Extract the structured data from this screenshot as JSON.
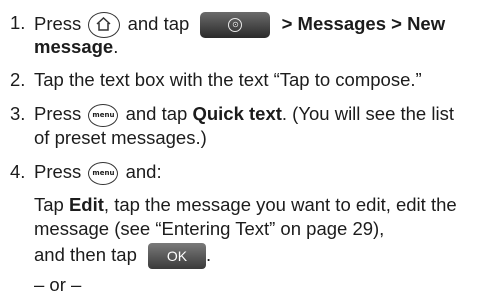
{
  "steps": [
    {
      "num": "1.",
      "press": "Press",
      "and_tap": "and tap",
      "path": "> Messages > New",
      "path_cont": "message",
      "period": "."
    },
    {
      "num": "2.",
      "text": "Tap the text box with the text “Tap to compose.”"
    },
    {
      "num": "3.",
      "press": "Press",
      "and_tap": "and tap",
      "bold": "Quick text",
      "rest": ". (You will see the list",
      "line2": "of preset messages.)"
    },
    {
      "num": "4.",
      "press": "Press",
      "and": "and:",
      "sub_tap": "Tap",
      "sub_edit": "Edit",
      "sub_rest": ", tap the message you want to edit, edit the",
      "sub_line2": "message (see “Entering Text” on page 29),",
      "sub_line3": "and then tap",
      "sub_period": ".",
      "or": "– or –"
    }
  ],
  "buttons": {
    "menu_label": "menu",
    "ok_label": "OK"
  },
  "icons": {
    "home": "home-icon",
    "all_apps": "all-apps-tab-icon",
    "menu": "menu-key-icon",
    "ok": "ok-button-icon"
  }
}
